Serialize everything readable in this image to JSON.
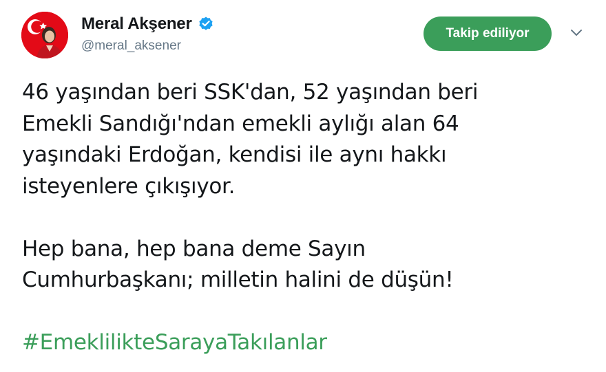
{
  "author": {
    "display_name": "Meral Akşener",
    "handle": "@meral_aksener",
    "verified_icon": "verified-badge-icon"
  },
  "follow_button": {
    "label": "Takip ediliyor"
  },
  "menu_icon": "chevron-down-icon",
  "tweet": {
    "lines_p1": [
      "46 yaşından beri SSK'dan, 52 yaşından beri",
      "Emekli Sandığı'ndan emekli aylığı alan 64",
      "yaşındaki Erdoğan, kendisi ile aynı hakkı",
      "isteyenlere çıkışıyor."
    ],
    "lines_p2": [
      "Hep bana, hep bana deme Sayın",
      "Cumhurbaşkanı; milletin halini de düşün!"
    ],
    "hashtag": "#EmeklilikteSarayaTakılanlar"
  },
  "colors": {
    "accent": "#3b9e5a",
    "verified": "#1da1f2",
    "text": "#14171a",
    "secondary_text": "#657786"
  }
}
